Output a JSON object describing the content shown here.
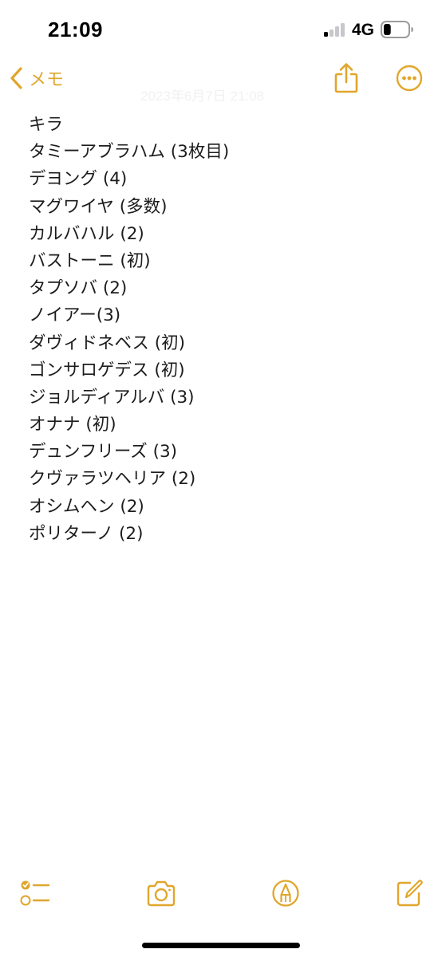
{
  "status_bar": {
    "time": "21:09",
    "network": "4G",
    "signal_bars_active": 1,
    "signal_bars_total": 4,
    "battery_level": 0.3
  },
  "nav": {
    "back_label": "メモ",
    "date_label": "2023年6月7日 21:08"
  },
  "note": {
    "lines": [
      "キラ",
      "タミーアブラハム (3枚目)",
      "デヨング (4)",
      "マグワイヤ (多数)",
      "カルバハル (2)",
      "バストーニ (初)",
      "タプソバ (2)",
      "ノイアー(3)",
      "ダヴィドネベス (初)",
      "ゴンサロゲデス (初)",
      "ジョルディアルバ (3)",
      "オナナ (初)",
      "デュンフリーズ (3)",
      "クヴァラツヘリア (2)",
      "オシムヘン (2)",
      "ポリターノ (2)"
    ]
  },
  "toolbar": {
    "icons": [
      "checklist-icon",
      "camera-icon",
      "markup-icon",
      "compose-icon"
    ]
  },
  "colors": {
    "accent": "#e0a62c",
    "text": "#1c1c1e",
    "background": "#ffffff"
  }
}
